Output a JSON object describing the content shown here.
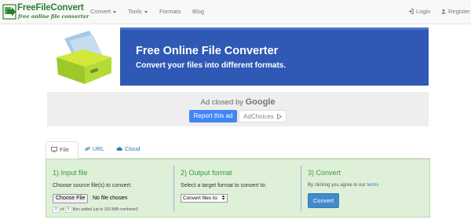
{
  "logo": {
    "title": "FreeFileConvert",
    "tagline": "free online file converter"
  },
  "nav": {
    "items": [
      {
        "label": "Convert",
        "dropdown": true
      },
      {
        "label": "Tools",
        "dropdown": true
      },
      {
        "label": "Formats",
        "dropdown": false
      },
      {
        "label": "Blog",
        "dropdown": false
      }
    ],
    "login_label": "Login",
    "register_label": "Register"
  },
  "banner": {
    "title": "Free Online File Converter",
    "subtitle": "Convert your files into different formats."
  },
  "ad": {
    "closed_text": "Ad closed by",
    "closed_brand": "Google",
    "report_label": "Report this ad",
    "adchoices_label": "AdChoices"
  },
  "tabs": [
    {
      "label": "File",
      "icon": "monitor-icon",
      "active": true
    },
    {
      "label": "URL",
      "icon": "link-icon",
      "active": false
    },
    {
      "label": "Cloud",
      "icon": "cloud-icon",
      "active": false
    }
  ],
  "steps": {
    "input": {
      "title": "1) Input file",
      "instruction": "Choose source file(s) to convert:",
      "choose_button": "Choose File",
      "no_file": "No file chosen",
      "files_count": "0",
      "of_text": "of",
      "files_max": "5",
      "files_note": "files added (up to 100 MiB combined)"
    },
    "output": {
      "title": "2) Output format",
      "instruction": "Select a target format to convert to:",
      "select_value": "Convert files to:"
    },
    "convert": {
      "title": "3) Convert",
      "terms_prefix": "By clicking you agree to our",
      "terms_link": "terms",
      "button_label": "Convert"
    }
  },
  "colors": {
    "accent": "#2f59b5",
    "logo_green": "#2e7d32",
    "panel_bg": "#dff0d8",
    "step_title": "#3c9a3c",
    "button_blue": "#428bca",
    "google_blue": "#4285f4"
  }
}
